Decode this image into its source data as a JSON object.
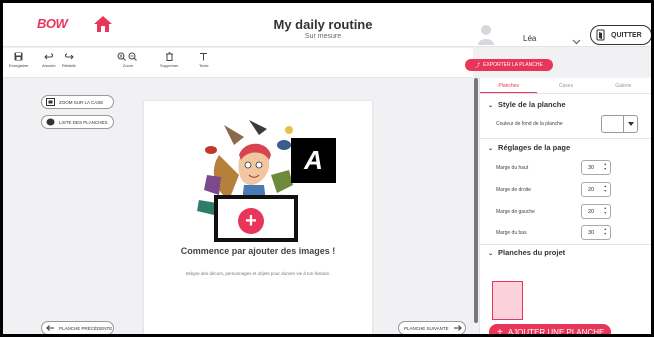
{
  "header": {
    "logo": "BOW",
    "title": "My daily routine",
    "subtitle": "Sur mesure",
    "username": "Léa",
    "quit_label": "QUITTER"
  },
  "toolbar": {
    "save": "Enregistrer",
    "undo": "Annuler",
    "redo": "Rétablir",
    "zoom": "Zoom",
    "delete": "Supprimer",
    "text": "Texte",
    "export_label": "EXPORTER LA PLANCHE"
  },
  "left": {
    "zoom_on_box": "ZOOM SUR LA CASE",
    "board_list": "LISTE DES PLANCHES",
    "prev_board": "PLANCHE PRÉCÉDENTE",
    "next_board": "PLANCHE SUIVANTE"
  },
  "canvas": {
    "badge": "A",
    "cta_title": "Commence par ajouter des images !",
    "cta_text": "Intègre des décors, personnages et objets pour donner vie à ton histoire."
  },
  "panel": {
    "tabs": [
      "Planches",
      "Cases",
      "Galerie"
    ],
    "active_tab": "Planches",
    "style_title": "Style de la planche",
    "bg_color_label": "Couleur de fond de la planche",
    "page_settings_title": "Réglages de la page",
    "margins": [
      {
        "label": "Marge du haut",
        "value": "30"
      },
      {
        "label": "Marge de droite",
        "value": "20"
      },
      {
        "label": "Marge de gauche",
        "value": "20"
      },
      {
        "label": "Marge du bas",
        "value": "30"
      }
    ],
    "project_boards_title": "Planches du projet",
    "add_board_label": "AJOUTER UNE PLANCHE"
  },
  "colors": {
    "accent": "#e8365b",
    "background": "#f1f1f4"
  }
}
